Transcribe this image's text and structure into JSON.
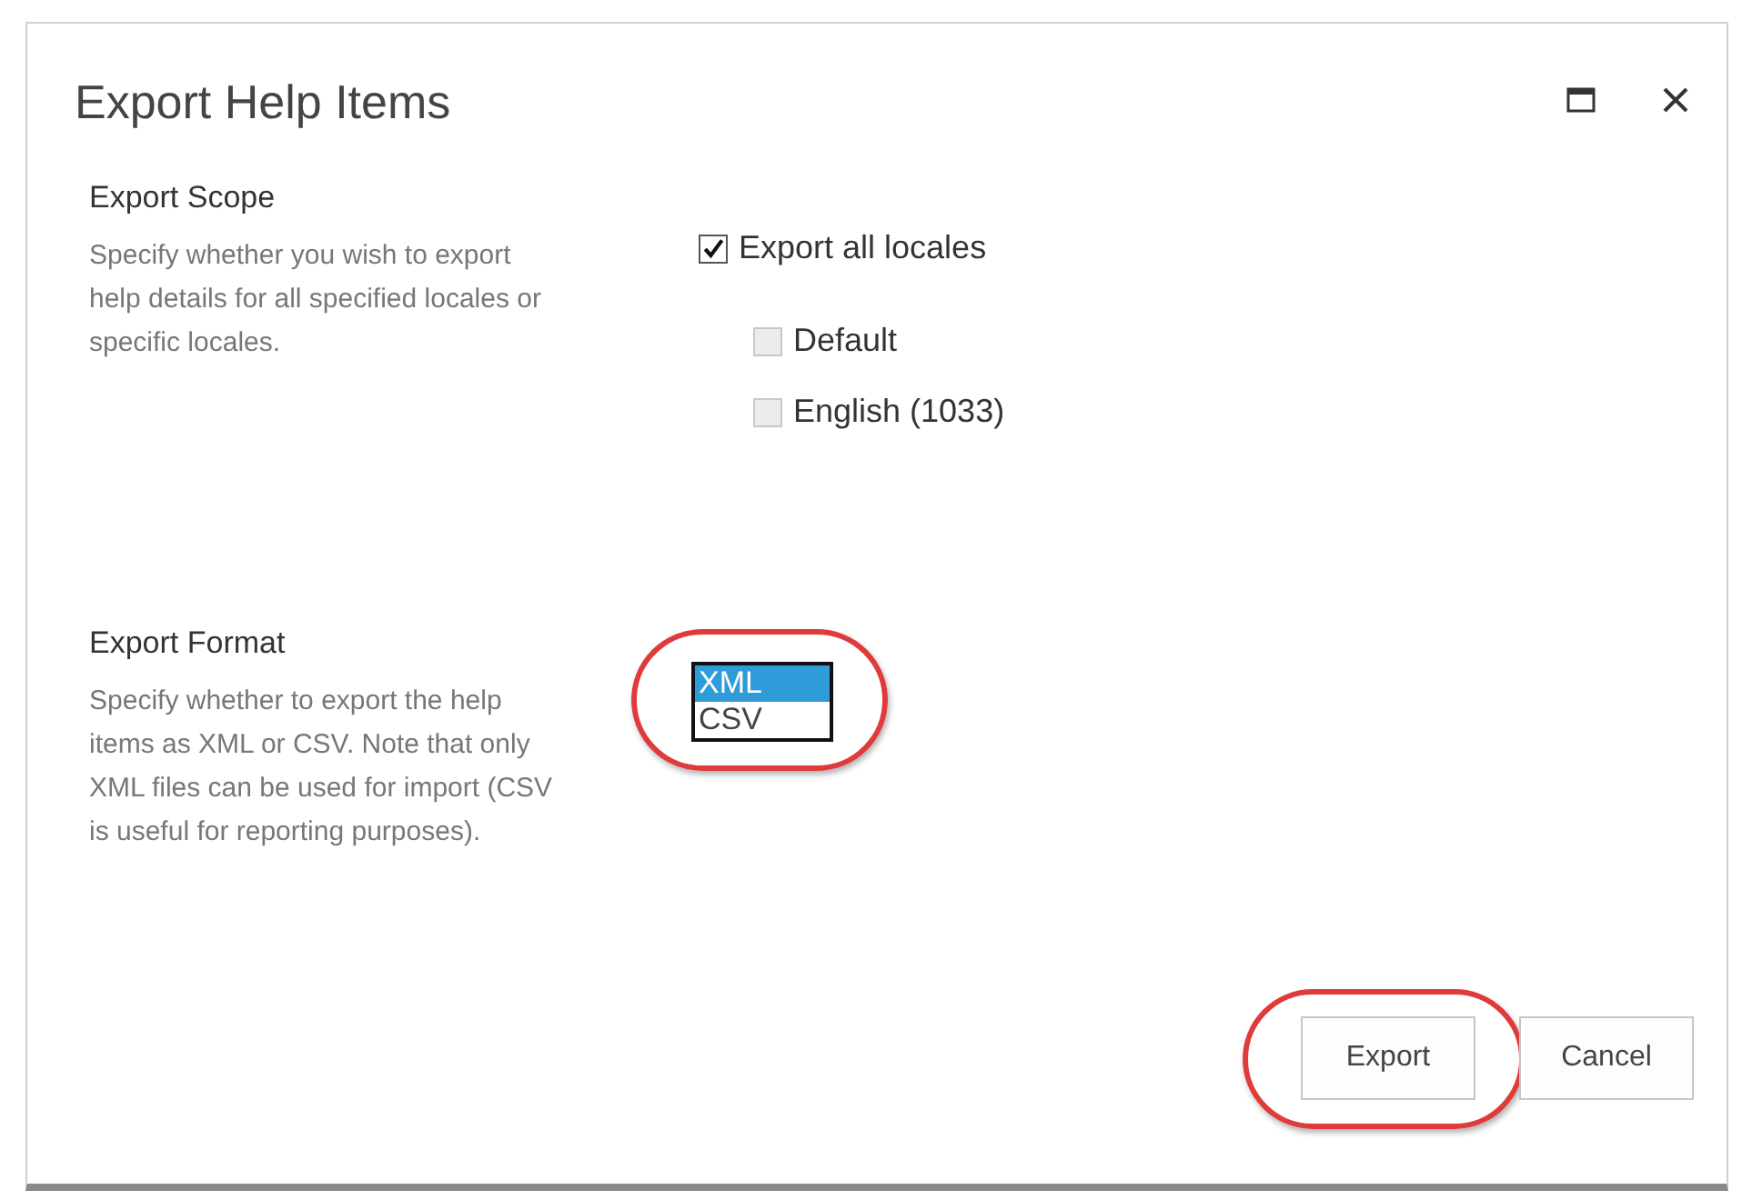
{
  "dialog": {
    "title": "Export Help Items"
  },
  "export_scope": {
    "heading": "Export Scope",
    "description": "Specify whether you wish to export help details for all specified locales or specific locales.",
    "export_all": {
      "label": "Export all locales",
      "checked": true,
      "disabled": false
    },
    "locales": [
      {
        "label": "Default",
        "checked": false,
        "disabled": true
      },
      {
        "label": "English (1033)",
        "checked": false,
        "disabled": true
      }
    ]
  },
  "export_format": {
    "heading": "Export Format",
    "description": "Specify whether to export the help items as XML or CSV. Note that only XML files can be used for import (CSV is useful for reporting purposes).",
    "listbox": {
      "circled": true,
      "options": [
        {
          "label": "XML",
          "selected": true
        },
        {
          "label": "CSV",
          "selected": false
        }
      ]
    }
  },
  "buttons": [
    {
      "label": "Export",
      "circled": true
    },
    {
      "label": "Cancel"
    }
  ]
}
